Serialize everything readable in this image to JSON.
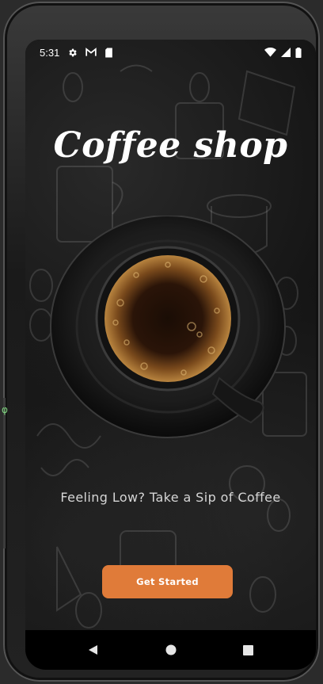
{
  "status_bar": {
    "time": "5:31",
    "icons_left": [
      "gear-icon",
      "gmail-icon",
      "sd-card-icon"
    ],
    "icons_right": [
      "wifi-icon",
      "signal-icon",
      "battery-icon"
    ]
  },
  "app": {
    "title": "Coffee shop",
    "tagline": "Feeling Low? Take a Sip of Coffee",
    "cta_label": "Get Started"
  },
  "nav_bar": {
    "buttons": [
      "back-icon",
      "home-icon",
      "recents-icon"
    ]
  },
  "colors": {
    "accent": "#e07b39",
    "background": "#141414",
    "text_primary": "#ffffff",
    "text_secondary": "#d6d6d6"
  }
}
